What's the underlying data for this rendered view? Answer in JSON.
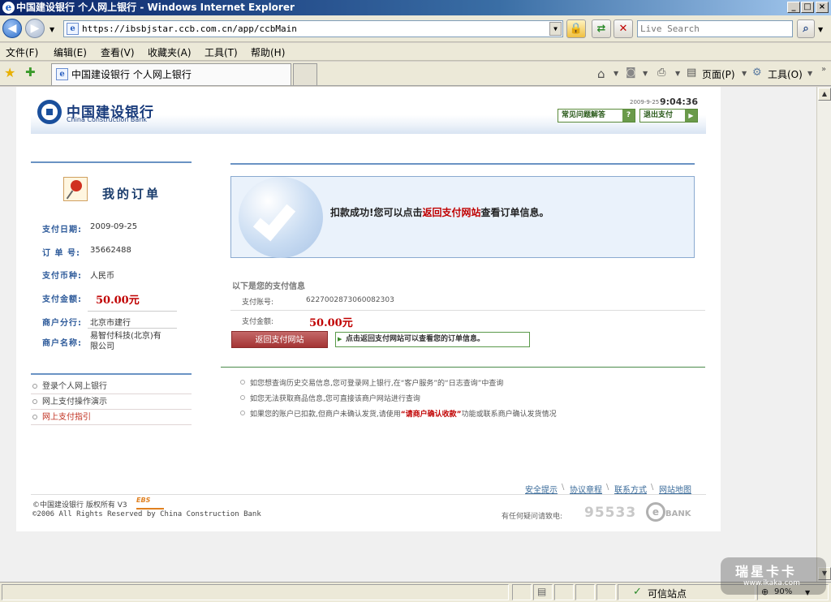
{
  "browser": {
    "title": "中国建设银行 个人网上银行 - Windows Internet Explorer",
    "window_buttons": {
      "minimize": "_",
      "maximize": "□",
      "close": "×"
    },
    "address": "https://ibsbjstar.ccb.com.cn/app/ccbMain",
    "search_placeholder": "Live Search",
    "menu": [
      "文件(F)",
      "编辑(E)",
      "查看(V)",
      "收藏夹(A)",
      "工具(T)",
      "帮助(H)"
    ],
    "tab_title": "中国建设银行 个人网上银行",
    "cmd_page": "页面(P)",
    "cmd_tools": "工具(O)",
    "status_trusted": "可信站点",
    "zoom": "90%"
  },
  "bank": {
    "logo_cn": "中国建设银行",
    "logo_en": "China Construction Bank",
    "date": "2009-9-25",
    "time": "9:04:36",
    "faq_button": "常见问题解答",
    "exit_button": "退出支付",
    "order": {
      "heading": "我的订单",
      "fields": [
        {
          "label": "支付日期:",
          "value": "2009-09-25"
        },
        {
          "label": "订 单 号:",
          "value": "35662488"
        },
        {
          "label": "支付币种:",
          "value": "人民币"
        },
        {
          "label": "支付金额:",
          "value": "50.00元"
        },
        {
          "label": "商户分行:",
          "value": "北京市建行"
        },
        {
          "label": "商户名称:",
          "value": "易智付科技(北京)有限公司"
        }
      ]
    },
    "left_links": [
      "登录个人网上银行",
      "网上支付操作演示",
      "网上支付指引"
    ],
    "success": {
      "prefix": "扣款成功!您可以点击",
      "link": "返回支付网站",
      "suffix": "查看订单信息。"
    },
    "pay_info": {
      "heading": "以下是您的支付信息",
      "account_label": "支付账号:",
      "account": "6227002873060082303",
      "amount_label": "支付金额:",
      "amount": "50.00元"
    },
    "return_button": "返回支付网站",
    "return_hint": "点击返回支付网站可以查看您的订单信息。",
    "tips": [
      "如您想查询历史交易信息,您可登录网上银行,在“客户服务”的“日志查询”中查询",
      "如您无法获取商品信息,您可直接该商户网站进行查询"
    ],
    "tip3": {
      "pre": "如果您的账户已扣款,但商户未确认发货,请使用",
      "highlight": "“请商户确认收款”",
      "post": "功能或联系商户确认发货情况"
    },
    "footer_links": [
      "安全提示",
      "协议章程",
      "联系方式",
      "网站地图"
    ],
    "copyright_cn": "©中国建设银行 版权所有 V3",
    "copyright_en": "©2006 All Rights Reserved by China Construction Bank",
    "hotline_label": "有任何疑问请致电:",
    "hotline": "95533",
    "ebank": "BANK"
  },
  "watermark": {
    "text": "瑞星卡卡",
    "url": "www.ikaka.com"
  }
}
